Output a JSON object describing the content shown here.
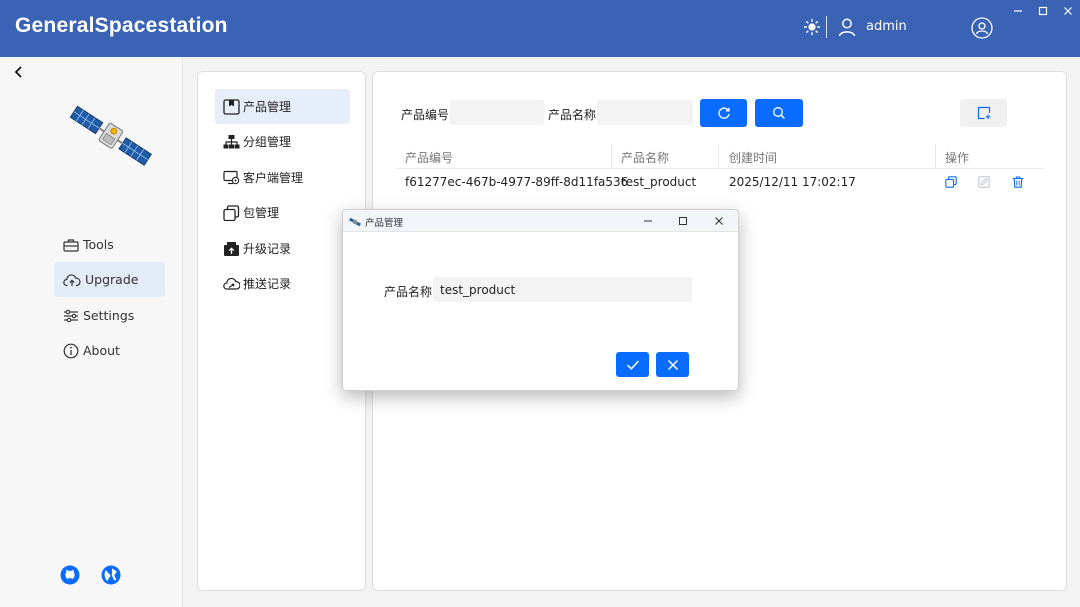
{
  "app": {
    "title": "GeneralSpacestation",
    "user": "admin"
  },
  "sidebar": {
    "items": [
      {
        "label": "Tools",
        "icon": "toolbox-icon"
      },
      {
        "label": "Upgrade",
        "icon": "cloud-upload-icon",
        "active": true
      },
      {
        "label": "Settings",
        "icon": "sliders-icon"
      },
      {
        "label": "About",
        "icon": "info-icon"
      }
    ],
    "footer": [
      {
        "icon": "github-icon"
      },
      {
        "icon": "globe-icon"
      }
    ]
  },
  "submenu": {
    "items": [
      {
        "label": "产品管理",
        "icon": "box-icon",
        "active": true
      },
      {
        "label": "分组管理",
        "icon": "hierarchy-icon"
      },
      {
        "label": "客户端管理",
        "icon": "client-icon"
      },
      {
        "label": "包管理",
        "icon": "package-icon"
      },
      {
        "label": "升级记录",
        "icon": "upgrade-record-icon"
      },
      {
        "label": "推送记录",
        "icon": "push-record-icon"
      }
    ]
  },
  "search": {
    "code_label": "产品编号",
    "code_value": "",
    "name_label": "产品名称",
    "name_value": ""
  },
  "table": {
    "columns": [
      "产品编号",
      "产品名称",
      "创建时间",
      "操作"
    ],
    "rows": [
      {
        "code": "f61277ec-467b-4977-89ff-8d11fa536",
        "name": "test_product",
        "created": "2025/12/11 17:02:17"
      }
    ]
  },
  "dialog": {
    "title": "产品管理",
    "field_label": "产品名称",
    "field_value": "test_product"
  },
  "colors": {
    "titlebar": "#3a63b5",
    "accent": "#0a6cff",
    "active_bg": "#e4ecf8"
  }
}
